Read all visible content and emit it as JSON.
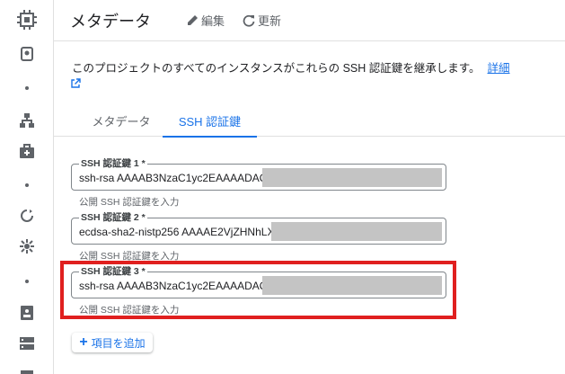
{
  "header": {
    "title": "メタデータ",
    "edit_label": "編集",
    "refresh_label": "更新"
  },
  "description": {
    "text": "このプロジェクトのすべてのインスタンスがこれらの SSH 認証鍵を継承します。",
    "link_label": "詳細"
  },
  "tabs": [
    {
      "label": "メタデータ",
      "active": false
    },
    {
      "label": "SSH 認証鍵",
      "active": true
    }
  ],
  "ssh_keys": [
    {
      "label": "SSH 認証鍵 1 *",
      "value": "ssh-rsa AAAAB3NzaC1yc2EAAAADAQA",
      "hint": "公開 SSH 認証鍵を入力"
    },
    {
      "label": "SSH 認証鍵 2 *",
      "value": "ecdsa-sha2-nistp256 AAAAE2VjZHNhLX",
      "hint": "公開 SSH 認証鍵を入力"
    },
    {
      "label": "SSH 認証鍵 3 *",
      "value": "ssh-rsa AAAAB3NzaC1yc2EAAAADAQA",
      "hint": "公開 SSH 認証鍵を入力"
    }
  ],
  "add_button": {
    "label": "項目を追加"
  },
  "rail_icons": [
    "compute-chip-icon",
    "disk-icon",
    "dot",
    "network-icon",
    "briefcase-icon",
    "dot",
    "refresh-ring-icon",
    "gear-icon",
    "dot",
    "badge-icon",
    "storage-icon",
    "more-icon"
  ],
  "colors": {
    "accent": "#1a73e8",
    "highlight": "#e0201f",
    "mask": "#c4c4c4"
  }
}
